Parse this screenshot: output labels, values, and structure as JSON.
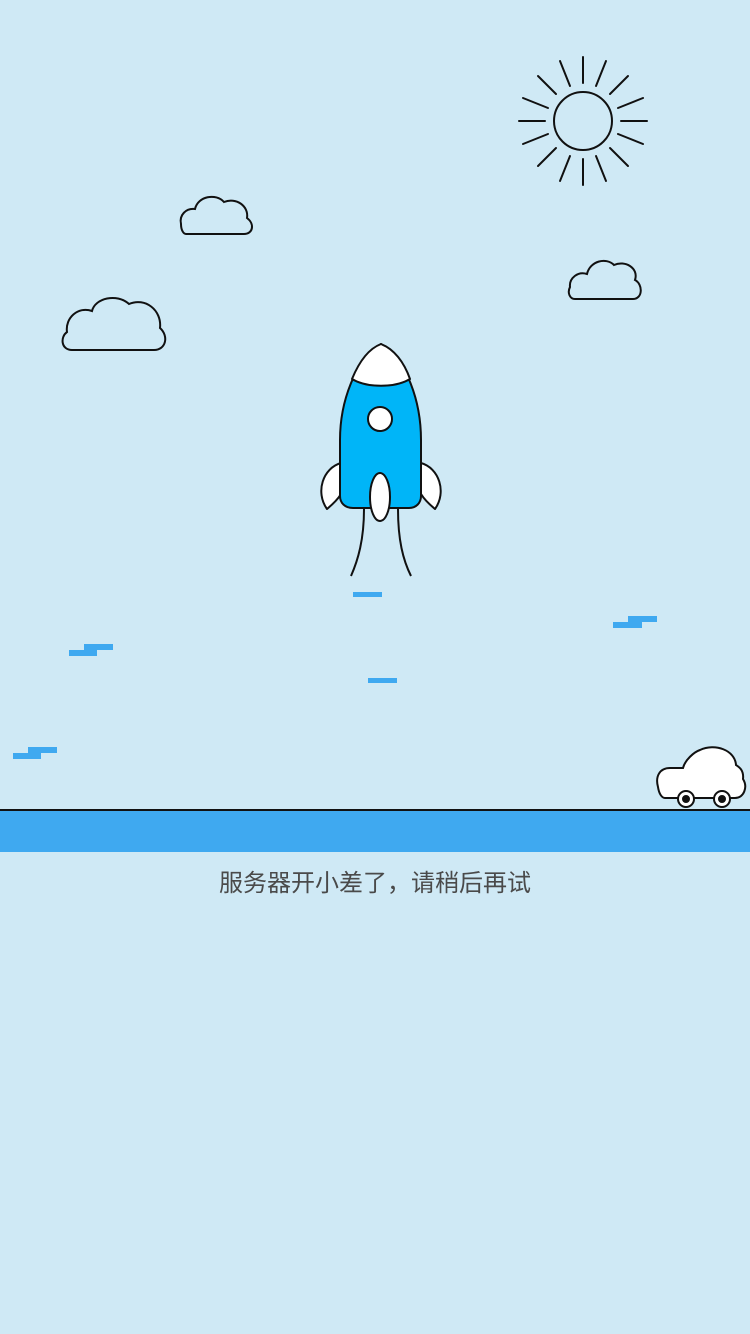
{
  "error": {
    "message": "服务器开小差了，请稍后再试"
  },
  "colors": {
    "background": "#cfe9f5",
    "rocket_body": "#00b5f8",
    "ground_band": "#3fa9f0",
    "accent_dash": "#3fa9f0",
    "line": "#111111",
    "text": "#4a4a4a"
  },
  "icons": {
    "sun": "sun-icon",
    "cloud": "cloud-icon",
    "rocket": "rocket-icon",
    "car": "car-icon"
  }
}
